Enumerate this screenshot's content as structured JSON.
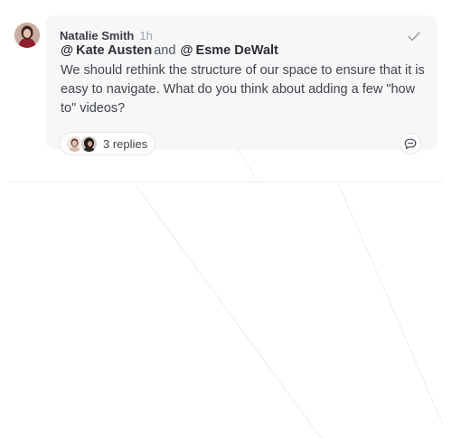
{
  "comment": {
    "author": "Natalie Smith",
    "time": "1h",
    "mentions": [
      {
        "at": "@",
        "name": "Kate Austen"
      },
      {
        "at": "@",
        "name": "Esme DeWalt"
      }
    ],
    "conjunction": "and",
    "message": "We should rethink the structure of our space to ensure that it is easy to navigate. What do you think about adding a few \"how to\" videos?",
    "replies_label": "3 replies"
  },
  "icons": {
    "resolve": "check-icon",
    "reply": "comment-bubble-icon"
  },
  "colors": {
    "card_bg": "#f7f7f8",
    "text": "#3f444d",
    "muted": "#9ca3af"
  }
}
